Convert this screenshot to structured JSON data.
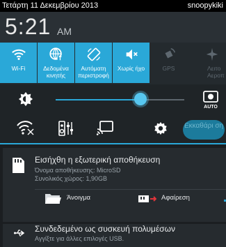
{
  "status_bar": {
    "date": "Τετάρτη 11 Δεκεμβρίου 2013",
    "user": "snoopykiki"
  },
  "clock": {
    "time": "5:21",
    "ampm": "AM"
  },
  "quick_settings": [
    {
      "label": "Wi-Fi",
      "icon": "wifi-icon",
      "state": "on"
    },
    {
      "label": "Δεδομένα κινητής",
      "icon": "mobile-data-icon",
      "state": "on"
    },
    {
      "label": "Αυτόματη περιστροφή",
      "icon": "rotate-icon",
      "state": "on"
    },
    {
      "label": "Χωρίς ήχο",
      "icon": "mute-icon",
      "state": "on"
    },
    {
      "label": "GPS",
      "icon": "gps-icon",
      "state": "off"
    },
    {
      "label": "Λειτο Αεροπ",
      "icon": "airplane-icon",
      "state": "off"
    }
  ],
  "brightness": {
    "level": 0.66,
    "auto_label": "AUTO",
    "accent": "#2aa8d8"
  },
  "toggles": {
    "pill_label": "Εκκαθάρι ση"
  },
  "notifications": {
    "storage": {
      "title": "Εισήχθη η εξωτερική αποθήκευση",
      "line1": "Όνομα αποθήκευσης: MicroSD",
      "line2": "Συνολικός χώρος: 1,90GB",
      "open_label": "Άνοιγμα",
      "remove_label": "Αφαίρεση"
    },
    "usb": {
      "title": "Συνδεδεμένο ως συσκευή πολυμέσων",
      "subtitle": "Αγγίξτε για άλλες επιλογές USB."
    }
  }
}
